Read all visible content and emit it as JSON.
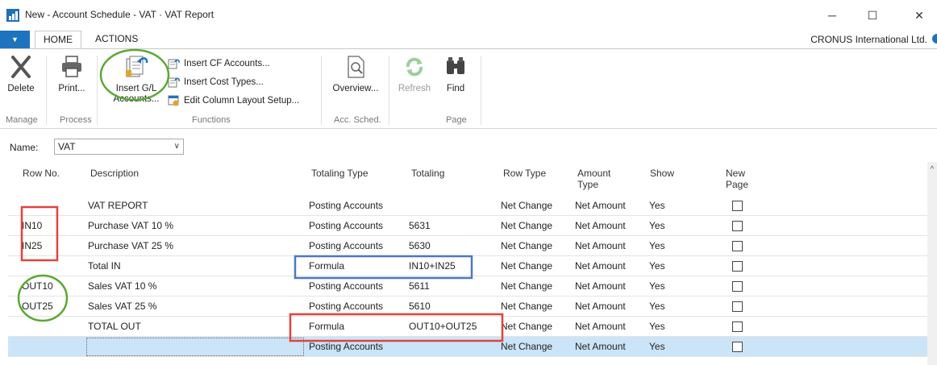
{
  "window": {
    "title": "New - Account Schedule - VAT · VAT Report",
    "minimize_glyph": "─",
    "maximize_glyph": "☐",
    "close_glyph": "✕"
  },
  "tabs": {
    "dropdown_glyph": "▼",
    "home": "HOME",
    "actions": "ACTIONS",
    "company": "CRONUS International Ltd."
  },
  "ribbon": {
    "manage": {
      "label": "Manage",
      "delete": "Delete"
    },
    "process": {
      "label": "Process",
      "print": "Print..."
    },
    "functions": {
      "label": "Functions",
      "insert_gl_line1": "Insert G/L",
      "insert_gl_line2": "Accounts...",
      "insert_cf": "Insert CF Accounts...",
      "insert_cost": "Insert Cost Types...",
      "edit_column": "Edit Column Layout Setup..."
    },
    "acc_sched": {
      "label": "Acc. Sched.",
      "overview": "Overview..."
    },
    "page": {
      "label": "Page",
      "refresh": "Refresh",
      "find": "Find"
    }
  },
  "name_field": {
    "label": "Name:",
    "value": "VAT",
    "caret": "∨"
  },
  "grid": {
    "headers": {
      "row_no": "Row No.",
      "description": "Description",
      "totaling_type": "Totaling Type",
      "totaling": "Totaling",
      "row_type": "Row Type",
      "amount_type_1": "Amount",
      "amount_type_2": "Type",
      "show": "Show",
      "new_page_1": "New",
      "new_page_2": "Page"
    },
    "rows": [
      {
        "row_no": "",
        "description": "VAT REPORT",
        "totaling_type": "Posting Accounts",
        "totaling": "",
        "row_type": "Net Change",
        "amount_type": "Net Amount",
        "show": "Yes"
      },
      {
        "row_no": "IN10",
        "description": "Purchase VAT 10 %",
        "totaling_type": "Posting Accounts",
        "totaling": "5631",
        "row_type": "Net Change",
        "amount_type": "Net Amount",
        "show": "Yes"
      },
      {
        "row_no": "IN25",
        "description": "Purchase VAT 25 %",
        "totaling_type": "Posting Accounts",
        "totaling": "5630",
        "row_type": "Net Change",
        "amount_type": "Net Amount",
        "show": "Yes"
      },
      {
        "row_no": "",
        "description": "Total IN",
        "totaling_type": "Formula",
        "totaling": "IN10+IN25",
        "row_type": "Net Change",
        "amount_type": "Net Amount",
        "show": "Yes"
      },
      {
        "row_no": "OUT10",
        "description": "Sales VAT 10 %",
        "totaling_type": "Posting Accounts",
        "totaling": "5611",
        "row_type": "Net Change",
        "amount_type": "Net Amount",
        "show": "Yes"
      },
      {
        "row_no": "OUT25",
        "description": "Sales VAT 25 %",
        "totaling_type": "Posting Accounts",
        "totaling": "5610",
        "row_type": "Net Change",
        "amount_type": "Net Amount",
        "show": "Yes"
      },
      {
        "row_no": "",
        "description": "TOTAL OUT",
        "totaling_type": "Formula",
        "totaling": "OUT10+OUT25",
        "row_type": "Net Change",
        "amount_type": "Net Amount",
        "show": "Yes"
      },
      {
        "row_no": "",
        "description": "",
        "totaling_type": "Posting Accounts",
        "totaling": "",
        "row_type": "Net Change",
        "amount_type": "Net Amount",
        "show": "Yes"
      }
    ]
  },
  "scroll_up_glyph": "^",
  "colors": {
    "accent": "#1e73be",
    "selection": "#cce4f7",
    "annotation_red": "#e0443d",
    "annotation_green": "#5aa832",
    "annotation_blue": "#4a78c2"
  }
}
